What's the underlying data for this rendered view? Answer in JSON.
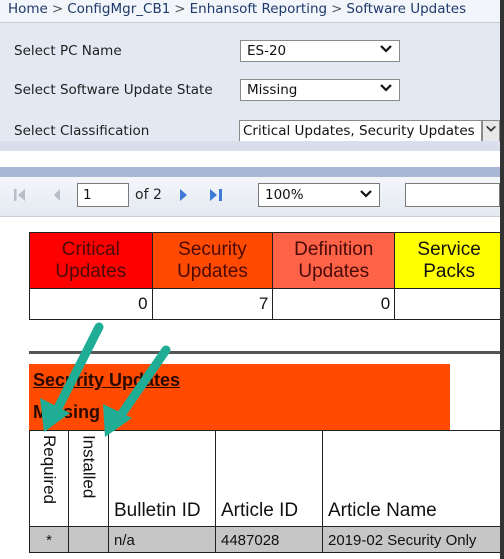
{
  "breadcrumb": [
    "Home",
    "ConfigMgr_CB1",
    "Enhansoft Reporting",
    "Software Updates"
  ],
  "parameters": [
    {
      "label": "Select PC Name",
      "value": "ES-20"
    },
    {
      "label": "Select Software Update State",
      "value": "Missing"
    },
    {
      "label": "Select Classification",
      "value": "Critical Updates, Security Updates"
    }
  ],
  "toolbar": {
    "current_page": "1",
    "page_of": "of 2",
    "zoom": "100%",
    "find_value": ""
  },
  "summary": {
    "columns": [
      {
        "label_line1": "Critical",
        "label_line2": "Updates",
        "value": "0",
        "color": "#ff0000"
      },
      {
        "label_line1": "Security",
        "label_line2": "Updates",
        "value": "7",
        "color": "#ff4a00"
      },
      {
        "label_line1": "Definition",
        "label_line2": "Updates",
        "value": "0",
        "color": "#ff6347"
      },
      {
        "label_line1": "Service",
        "label_line2": "Packs",
        "value": "",
        "color": "#ffff00"
      }
    ]
  },
  "section": {
    "title": "Security Updates",
    "subtitle": "Missing",
    "color": "#ff4a00"
  },
  "detail_table": {
    "headers": [
      "Required",
      "Installed",
      "Bulletin ID",
      "Article ID",
      "Article Name"
    ],
    "rows": [
      {
        "required": "*",
        "installed": "",
        "bulletin_id": "n/a",
        "article_id": "4487028",
        "article_name": "2019-02 Security Only"
      }
    ]
  },
  "annotation": {
    "arrow_color": "#1fae95"
  }
}
